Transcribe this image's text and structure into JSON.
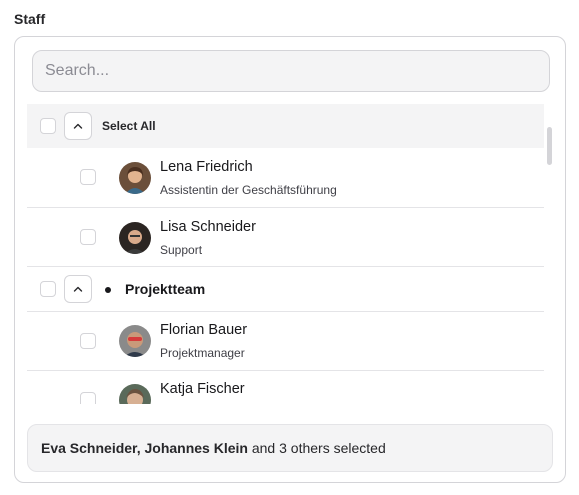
{
  "field": {
    "label": "Staff"
  },
  "search": {
    "placeholder": "Search...",
    "value": ""
  },
  "select_all": {
    "label": "Select All",
    "checked": false
  },
  "items": [
    {
      "name": "Lena Friedrich",
      "role": "Assistentin der Geschäftsführung",
      "checked": false
    },
    {
      "name": "Lisa Schneider",
      "role": "Support",
      "checked": false
    }
  ],
  "group": {
    "name": "Projektteam",
    "checked": false,
    "expanded": true
  },
  "group_items": [
    {
      "name": "Florian Bauer",
      "role": "Projektmanager",
      "checked": false
    },
    {
      "name": "Katja Fischer",
      "role": "",
      "checked": false
    }
  ],
  "footer": {
    "selected_names": "Eva Schneider, Johannes Klein",
    "suffix": "and 3 others selected"
  },
  "icons": {
    "collapse": "chevron-up-icon",
    "group_bullet": "bullet-icon"
  },
  "colors": {
    "border": "#d4d4d8",
    "muted_bg": "#f4f4f5",
    "text": "#18181b"
  }
}
